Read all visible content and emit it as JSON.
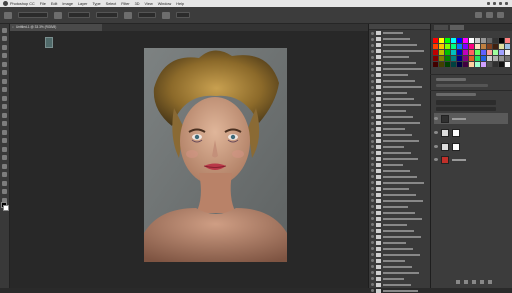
{
  "menubar": {
    "items": [
      "Photoshop CC",
      "File",
      "Edit",
      "Image",
      "Layer",
      "Type",
      "Select",
      "Filter",
      "3D",
      "View",
      "Window",
      "Help"
    ]
  },
  "document": {
    "tab_label": "Untitled-1 @ 33.3% (RGB/8)"
  },
  "colors": {
    "accent": "#bdbdbd",
    "background": "#2a2a2a",
    "layer_red": "#c0302a"
  },
  "swatches": [
    "#ff0000",
    "#ffff00",
    "#00ff00",
    "#00ffff",
    "#0000ff",
    "#ff00ff",
    "#ffffff",
    "#cccccc",
    "#999999",
    "#666666",
    "#333333",
    "#000000",
    "#ff8080",
    "#ff4000",
    "#ffc000",
    "#80ff00",
    "#00ff80",
    "#0080ff",
    "#8000ff",
    "#ff0080",
    "#ffe0c0",
    "#c08040",
    "#804020",
    "#402010",
    "#e0e0a0",
    "#a0c0e0",
    "#c00000",
    "#c0c000",
    "#00c000",
    "#00c0c0",
    "#0000c0",
    "#c000c0",
    "#ff6060",
    "#60ff60",
    "#6060ff",
    "#ffa0a0",
    "#a0ffa0",
    "#a0a0ff",
    "#f0f0f0",
    "#800000",
    "#808000",
    "#008000",
    "#008080",
    "#000080",
    "#800080",
    "#e06020",
    "#20e060",
    "#2060e0",
    "#d0d0d0",
    "#b0b0b0",
    "#909090",
    "#707070",
    "#400000",
    "#404000",
    "#004000",
    "#004040",
    "#000040",
    "#400040",
    "#ffd0a0",
    "#a0ffd0",
    "#d0a0ff",
    "#505050",
    "#303030",
    "#101010",
    "#f8f8f8"
  ]
}
